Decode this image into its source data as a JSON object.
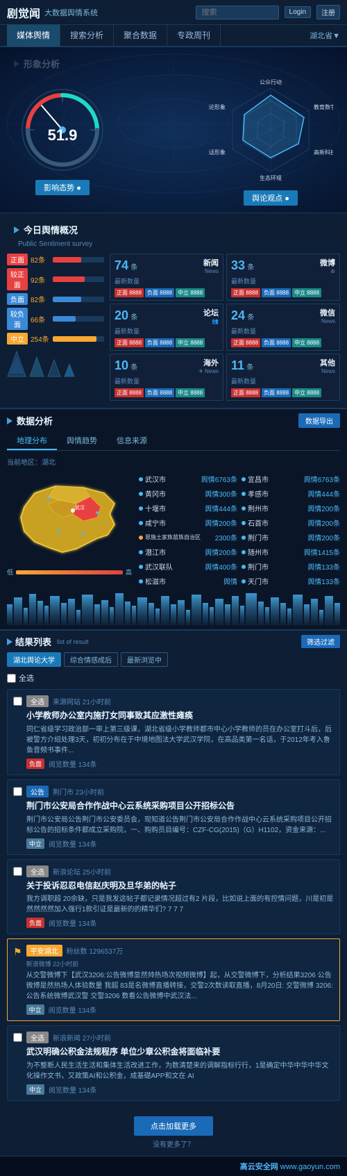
{
  "header": {
    "logo": "剧觉闻",
    "subtitle": "大数据舆情系统",
    "search_placeholder": "搜索",
    "login_label": "Login",
    "register_label": "注册"
  },
  "nav": {
    "items": [
      "媒体舆情",
      "搜索分析",
      "聚合数据",
      "专政周刊"
    ],
    "active": 0,
    "location": "湖北省▼"
  },
  "image_analysis": {
    "section_title": "形象分析",
    "gauge_value": "51.9",
    "gauge_btn": "影响态势 ●",
    "radar_btn": "舆论观点 ●",
    "radar_labels": [
      "公众行动",
      "教育数字",
      "高新科技",
      "生态环境",
      "投话形象",
      "舆论形象"
    ]
  },
  "sentiment": {
    "section_title": "今日舆情概况",
    "subtitle": "Public Sentiment survey",
    "bars": [
      {
        "label": "正面",
        "type": "positive",
        "value": "82条",
        "pct": 55
      },
      {
        "label": "较正面",
        "type": "cautious",
        "value": "92条",
        "pct": 62
      },
      {
        "label": "负面",
        "type": "negative",
        "value": "82条",
        "pct": 55
      },
      {
        "label": "较负面",
        "type": "neutral",
        "value": "66条",
        "pct": 44
      },
      {
        "label": "中立",
        "type": "other",
        "value": "254条",
        "pct": 85
      }
    ],
    "news_cards": [
      {
        "count": "74",
        "unit": "条",
        "desc": "最新数量",
        "type": "新闻",
        "type_icon": "News",
        "tags": [
          "正面 8888",
          "负面 8888",
          "中立 8888"
        ]
      },
      {
        "count": "33",
        "unit": "条",
        "desc": "最新数量",
        "type": "微博",
        "type_icon": "⊛",
        "tags": [
          "正面 8888",
          "负面 8888",
          "中立 8888"
        ]
      },
      {
        "count": "20",
        "unit": "条",
        "desc": "最新数量",
        "type": "论坛",
        "type_icon": "👥",
        "tags": [
          "正面 8888",
          "负面 8888",
          "中立 8888"
        ]
      },
      {
        "count": "24",
        "unit": "条",
        "desc": "最新数量",
        "type": "微信",
        "type_icon": "News",
        "tags": [
          "正面 8888",
          "负面 8888",
          "中立 8888"
        ]
      },
      {
        "count": "10",
        "unit": "条",
        "desc": "最新数量",
        "type": "海外",
        "type_icon": "✈ News",
        "tags": [
          "正面 8888",
          "负面 8888",
          "中立 8888"
        ]
      },
      {
        "count": "11",
        "unit": "条",
        "desc": "最新数量",
        "type": "其他",
        "type_icon": "News",
        "tags": [
          "正面 8888",
          "负面 8888",
          "中立 8888"
        ]
      }
    ]
  },
  "data_analysis": {
    "section_title": "数据分析",
    "export_btn": "数据导出",
    "tabs": [
      "地理分布",
      "舆情趋势",
      "信息来源"
    ],
    "active_tab": 0,
    "region_label": "当前地区：湖北",
    "regions_left": [
      {
        "name": "武汉市",
        "count": "舆情6763条"
      },
      {
        "name": "黄冈市",
        "count": "舆情300条"
      },
      {
        "name": "十堰市",
        "count": "舆情444条"
      },
      {
        "name": "咸宁市",
        "count": "舆情200条"
      },
      {
        "name": "恩施土家族苗族自治区",
        "count": "舆情2300条"
      },
      {
        "name": "潜江市",
        "count": "舆情200条"
      },
      {
        "name": "武汉联队",
        "count": "舆情400条"
      },
      {
        "name": "松滋市",
        "count": "舆情"
      }
    ],
    "regions_right": [
      {
        "name": "宜昌市",
        "count": "舆情6763条"
      },
      {
        "name": "孝感市",
        "count": "舆情444条"
      },
      {
        "name": "荆州市",
        "count": "舆情200条"
      },
      {
        "name": "石首市",
        "count": "舆情200条"
      },
      {
        "name": "荆门市",
        "count": "舆情200条"
      },
      {
        "name": "随州市",
        "count": "舆情1415条"
      },
      {
        "name": "荆门市",
        "count": "舆情133条"
      },
      {
        "name": "天门市",
        "count": "舆情133条"
      }
    ]
  },
  "results": {
    "section_title": "结果列表",
    "subtitle": "list of result",
    "filter_btn": "筛选过滤",
    "filter_options": [
      {
        "label": "湖北舆论大学",
        "active": true
      },
      {
        "label": "综合情感成后",
        "active": false
      },
      {
        "label": "最新浏览中",
        "active": false
      }
    ],
    "category_label": "全选",
    "articles": [
      {
        "type_badge": "全选",
        "type_class": "badge-meeting",
        "title": "小学教师办公室内施打女同事致其应激性瘫痪",
        "meta": "来源网站 21小时前",
        "excerpt": "同仁省级学习政治部一审上第三级课，湖北省级小学教师都市中心小学教师的员在办公室打斗后，后被警方介绍处理3天，初初分布在于中境地图法大学武汉学院，在高品类第一名话，于2012年考入鲁鱼音频书事件...",
        "sentiment": "负面",
        "sentiment_class": "badge-positive",
        "stats": "阅览数量 134条"
      },
      {
        "type_badge": "公告",
        "type_class": "badge-notice",
        "title": "荆门市公安局合作作战中心云系统采购项目公开招标公告",
        "meta": "荆门市 23小时前",
        "excerpt": "荆门市公安局公告荆门市公安委员会，现知道公告荆门市公安局合作作战中心云系统采购项目公开招标公告的招标条件都成立采购院，一、购购员目编号：CZF-CG(2015)（G）H1102，资金来源：...",
        "sentiment": "中立",
        "sentiment_class": "badge-neutral",
        "stats": "阅览数量 134条"
      },
      {
        "type_badge": "全选",
        "type_class": "badge-meeting",
        "title": "关于投诉忍忍电信赵庆明及旦华弟的帖子",
        "meta": "新浪论坛 25小时前",
        "excerpt": "我方调职超 20余缺，只是我发这帖子都记录情况超过有2 片段，比如说上面的有控情问题，川是初是然然然然加入强行1款引证是最新的的精华们? 7 7 7",
        "sentiment": "负面",
        "sentiment_class": "badge-positive",
        "stats": "阅览数量 134条"
      },
      {
        "type_badge": "平安湖北",
        "type_class": "badge-weibo",
        "title": "",
        "meta": "粉丝数 1296537万",
        "extra_meta": "新浪微博 22小时前",
        "excerpt": "从交警微博下【武汉3206:公告微博显然帅热场次视频微博】起，从交警微博下，分析结果3206 公告微博是然热场人体验数量 我超 8 3是名微博直播转接，交警2次数读取直播，8月20 日: 交警微博 3206:公告系统微博武汉警 交警3206 数看公告微博中武汉法 ...",
        "sentiment": "中立",
        "sentiment_class": "badge-neutral",
        "stats": "阅览数量 134条"
      },
      {
        "type_badge": "全选",
        "type_class": "badge-meeting",
        "title": "武汉明确公积金法规程序 单位少章公积金将面临补要",
        "meta": "新浪新闻 27小时前",
        "excerpt": "为不整断人民生活生活和集体生活改进工作，为数清楚来的调解指标行行，1是确定中华中华中华文化操作文书，又政策AI和公积金，成基礎APP和文在 AI",
        "sentiment": "中立",
        "sentiment_class": "badge-neutral",
        "stats": "阅览数量 134条"
      }
    ],
    "load_more_btn": "点击加载更多",
    "no_more_text": "没有更多了？"
  },
  "footer": {
    "logo_text": "高云安全网",
    "url": "www.gaoyun.com"
  }
}
